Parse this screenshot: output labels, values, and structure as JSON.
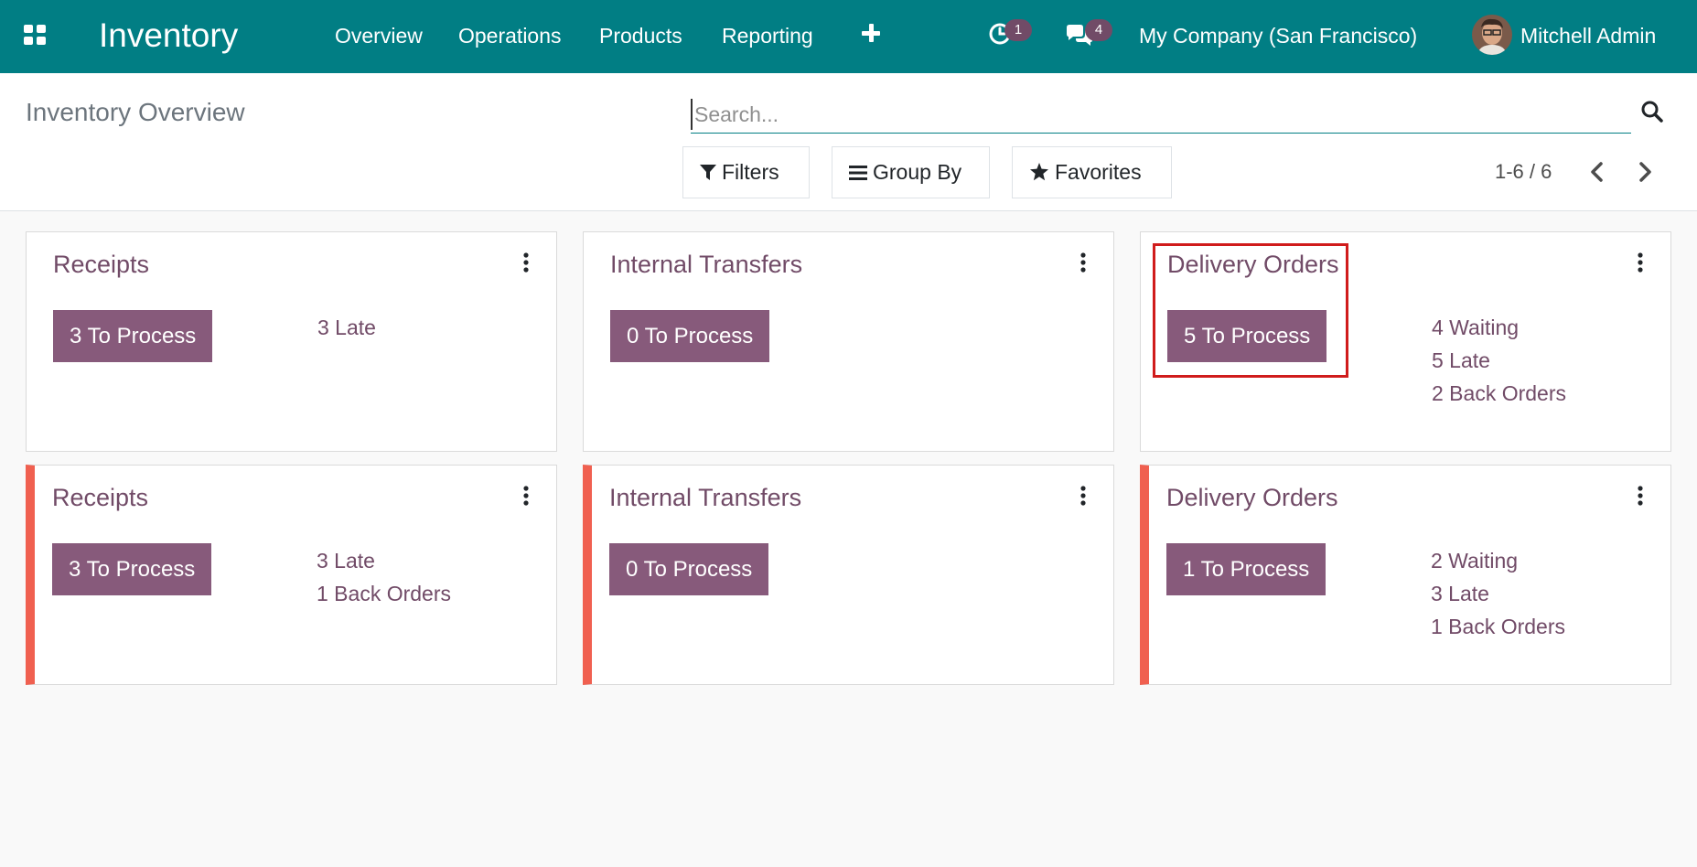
{
  "navbar": {
    "app_title": "Inventory",
    "menu": [
      {
        "label": "Overview"
      },
      {
        "label": "Operations"
      },
      {
        "label": "Products"
      },
      {
        "label": "Reporting"
      }
    ],
    "activity_count": "1",
    "messages_count": "4",
    "company": "My Company (San Francisco)",
    "user": "Mitchell Admin",
    "colors": {
      "bar": "#017e84",
      "badge": "#714b67"
    }
  },
  "control_panel": {
    "title": "Inventory Overview",
    "search_placeholder": "Search...",
    "filters_label": "Filters",
    "group_by_label": "Group By",
    "favorites_label": "Favorites",
    "pager": "1-6 / 6"
  },
  "cards": [
    {
      "title": "Receipts",
      "process_label": "3 To Process",
      "stats": [
        "3 Late"
      ],
      "flagged": false
    },
    {
      "title": "Internal Transfers",
      "process_label": "0 To Process",
      "stats": [],
      "flagged": false
    },
    {
      "title": "Delivery Orders",
      "process_label": "5 To Process",
      "stats": [
        "4 Waiting",
        "5 Late",
        "2 Back Orders"
      ],
      "flagged": false
    },
    {
      "title": "Receipts",
      "process_label": "3 To Process",
      "stats": [
        "3 Late",
        "1 Back Orders"
      ],
      "flagged": true
    },
    {
      "title": "Internal Transfers",
      "process_label": "0 To Process",
      "stats": [],
      "flagged": true
    },
    {
      "title": "Delivery Orders",
      "process_label": "1 To Process",
      "stats": [
        "2 Waiting",
        "3 Late",
        "1 Back Orders"
      ],
      "flagged": true
    }
  ],
  "colors": {
    "accent": "#875a7b",
    "title": "#714b67",
    "flag": "#f06050",
    "highlight": "#d01c1c"
  }
}
